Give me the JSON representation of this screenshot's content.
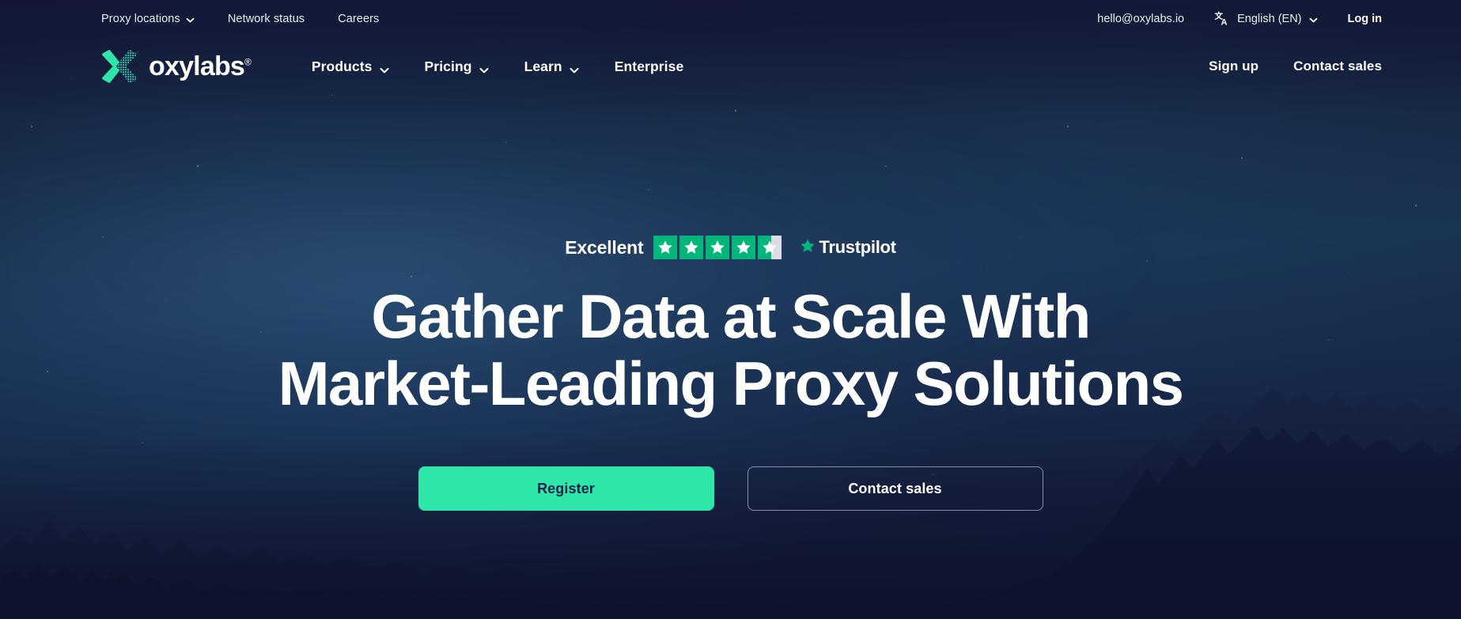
{
  "utility_bar": {
    "links": [
      {
        "label": "Proxy locations",
        "has_chevron": true,
        "icon": "chevron-down-icon"
      },
      {
        "label": "Network status",
        "has_chevron": false
      },
      {
        "label": "Careers",
        "has_chevron": false
      }
    ],
    "email": "hello@oxylabs.io",
    "language": {
      "icon": "translate-icon",
      "label": "English (EN)",
      "chevron": "chevron-down-icon"
    },
    "login_label": "Log in"
  },
  "nav": {
    "brand": {
      "name": "oxylabs",
      "registered_mark": "®",
      "logo_icon": "oxylabs-x-logo-icon"
    },
    "items": [
      {
        "label": "Products",
        "has_chevron": true
      },
      {
        "label": "Pricing",
        "has_chevron": true
      },
      {
        "label": "Learn",
        "has_chevron": true
      },
      {
        "label": "Enterprise",
        "has_chevron": false
      }
    ],
    "actions": [
      {
        "label": "Sign up"
      },
      {
        "label": "Contact sales"
      }
    ]
  },
  "hero": {
    "trustpilot": {
      "rating_word": "Excellent",
      "stars_total": 5,
      "stars_filled": 4,
      "partial_fill_percent": 55,
      "brand_name": "Trustpilot",
      "star_icon": "star-icon",
      "brand_star_icon": "trustpilot-star-icon"
    },
    "title_line1": "Gather Data at Scale With",
    "title_line2": "Market-Leading Proxy Solutions",
    "primary_button": "Register",
    "secondary_button": "Contact sales"
  },
  "colors": {
    "accent_green": "#2EE6A8",
    "trustpilot_green": "#00B67A",
    "background_navy": "#131A38",
    "text_white": "#FFFFFF",
    "primary_button_text": "#11224A"
  }
}
